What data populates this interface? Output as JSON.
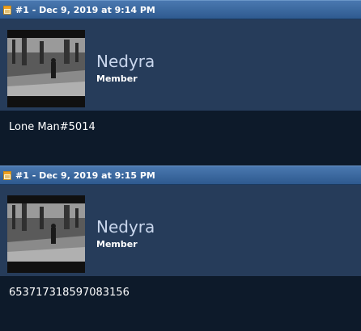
{
  "posts": [
    {
      "header": "#1 - Dec 9, 2019 at 9:14 PM",
      "username": "Nedyra",
      "user_title": "Member",
      "message": "Lone Man#5014"
    },
    {
      "header": "#1 - Dec 9, 2019 at 9:15 PM",
      "username": "Nedyra",
      "user_title": "Member",
      "message": "653717318597083156"
    }
  ],
  "colors": {
    "header_bar": "#2e5a8f",
    "user_panel": "#263c5a",
    "body_bg": "#0d1a2a",
    "username": "#c9d6ec"
  },
  "icons": {
    "post_icon": "post-document-icon",
    "avatar": "avatar-photo"
  }
}
